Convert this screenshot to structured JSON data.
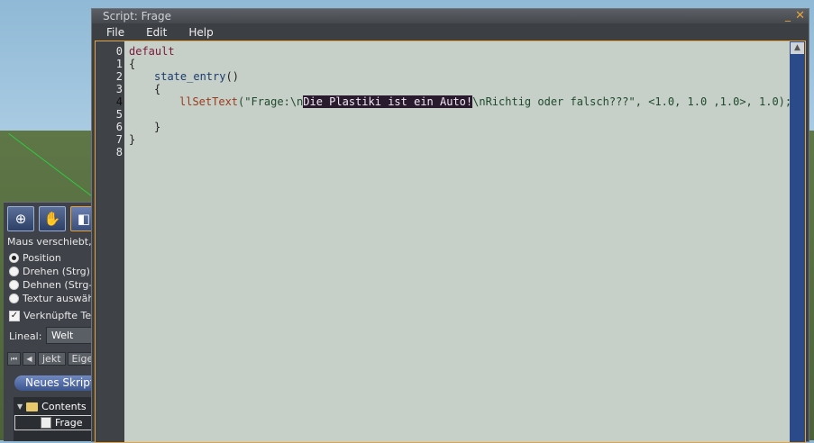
{
  "build_panel": {
    "tools": [
      {
        "icon": "zoom-icon"
      },
      {
        "icon": "grab-hand-icon"
      },
      {
        "icon": "edit-icon"
      }
    ],
    "hint": "Maus verschiebt, U",
    "options": [
      {
        "label": "Position",
        "checked": true
      },
      {
        "label": "Drehen (Strg)",
        "checked": false
      },
      {
        "label": "Dehnen (Strg-U",
        "checked": false
      },
      {
        "label": "Textur auswähl",
        "checked": false
      }
    ],
    "linked_label": "Verknüpfte Teil",
    "ruler_label": "Lineal:",
    "ruler_value": "Welt",
    "tabs": [
      "jekt",
      "Eigens"
    ],
    "new_script_button": "Neues Skript",
    "tree": {
      "folder": "Contents",
      "item": "Frage"
    }
  },
  "window": {
    "title": "Script: Frage",
    "menu": [
      "File",
      "Edit",
      "Help"
    ]
  },
  "editor": {
    "line_numbers": [
      "0",
      "1",
      "2",
      "3",
      "4",
      "5",
      "6",
      "7",
      "8"
    ],
    "current_line": 4,
    "lines": {
      "l0": "default",
      "l1": "{",
      "l2_event": "state_entry",
      "l2_rest": "()",
      "l3": "{",
      "l4_func": "llSetText",
      "l4_pre": "(\"Frage:\\n",
      "l4_sel": "Die Plastiki ist ein Auto!",
      "l4_post": "\\nRichtig oder falsch???\", <1.0, 1.0 ,1.0>, 1.0);",
      "l5": "",
      "l6": "}",
      "l7": "}",
      "l8": ""
    }
  },
  "colors": {
    "accent": "#e6a43a",
    "editor_bg": "#c6d0c8",
    "selection_bg": "#2a1a2e",
    "scrollbar": "#2a4a8a"
  }
}
